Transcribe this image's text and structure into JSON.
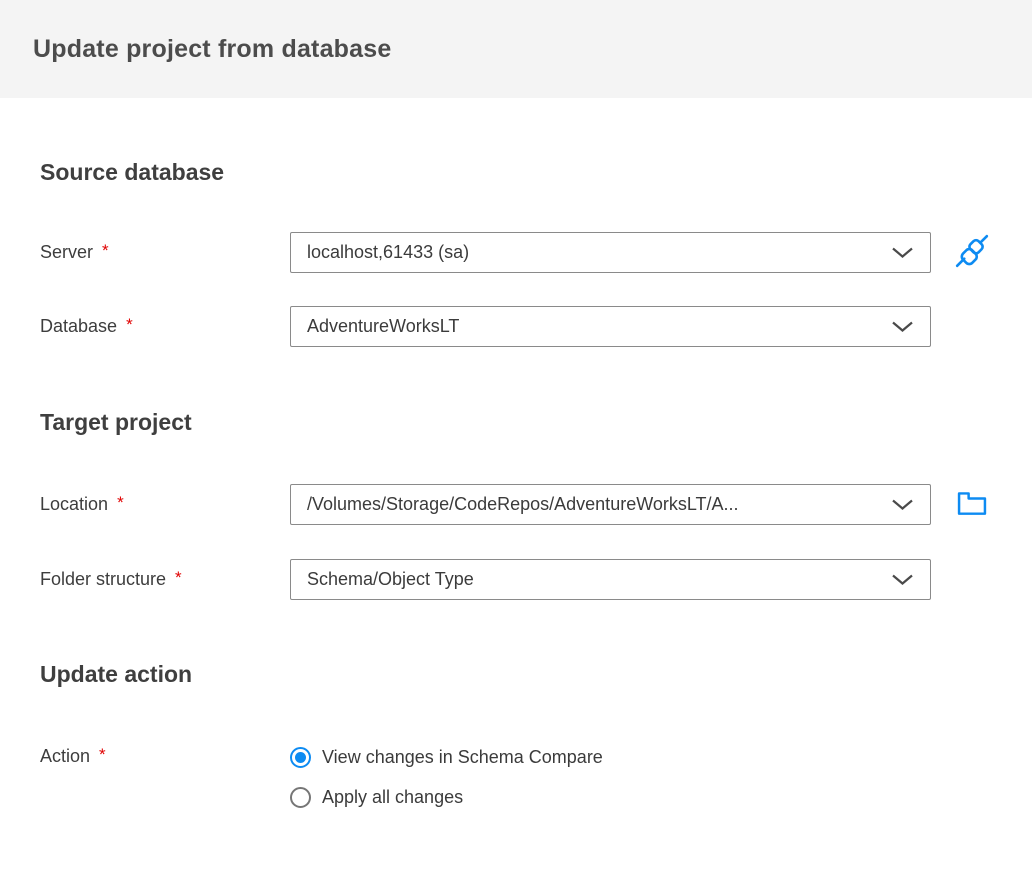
{
  "ui": {
    "required_marker": "*"
  },
  "header": {
    "title": "Update project from database"
  },
  "sections": {
    "source": {
      "heading": "Source database",
      "server": {
        "label": "Server",
        "value": "localhost,61433 (sa)"
      },
      "database": {
        "label": "Database",
        "value": "AdventureWorksLT"
      }
    },
    "target": {
      "heading": "Target project",
      "location": {
        "label": "Location",
        "value": "/Volumes/Storage/CodeRepos/AdventureWorksLT/A..."
      },
      "folder_structure": {
        "label": "Folder structure",
        "value": "Schema/Object Type"
      }
    },
    "update": {
      "heading": "Update action",
      "action": {
        "label": "Action",
        "options": [
          {
            "label": "View changes in Schema Compare",
            "selected": true
          },
          {
            "label": "Apply all changes",
            "selected": false
          }
        ]
      }
    }
  },
  "icons": {
    "connect": "connect-plug-icon",
    "folder": "folder-browse-icon",
    "chevron": "chevron-down-icon"
  },
  "colors": {
    "accent_blue": "#0d8bf2",
    "required_red": "#e00000",
    "header_bg": "#f4f4f4",
    "dropdown_border": "#8a8a8a",
    "text_dark": "#3b3b3b"
  }
}
